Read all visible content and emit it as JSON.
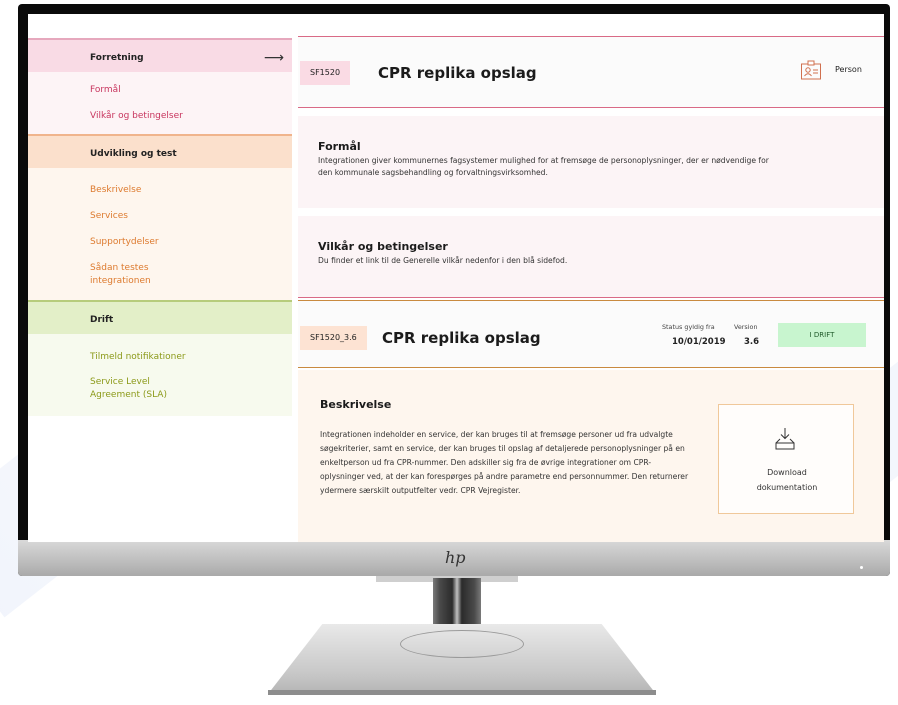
{
  "sidebar": {
    "forretning": {
      "title": "Forretning",
      "arrow": "⟶",
      "links": [
        "Formål",
        "Vilkår og betingelser"
      ]
    },
    "udvikling": {
      "title": "Udvikling og test",
      "links": [
        "Beskrivelse",
        "Services",
        "Supportydelser",
        "Sådan testes integrationen"
      ]
    },
    "drift": {
      "title": "Drift",
      "links": [
        "Tilmeld notifikationer",
        "Service Level Agreement (SLA)"
      ]
    }
  },
  "header": {
    "code": "SF1520",
    "title": "CPR replika opslag",
    "person_label": "Person"
  },
  "formaal": {
    "heading": "Formål",
    "text": "Integrationen giver kommunernes fagsystemer mulighed for at fremsøge de personoplysninger, der er nødvendige for den kommunale sagsbehandling og forvaltningsvirksomhed."
  },
  "vilkaar": {
    "heading": "Vilkår og betingelser",
    "text": "Du finder et link til de Generelle vilkår nedenfor i den blå sidefod."
  },
  "version_header": {
    "code": "SF1520_3.6",
    "title": "CPR replika opslag",
    "status_label": "Status gyldig fra",
    "status_date": "10/01/2019",
    "version_label": "Version",
    "version_value": "3.6",
    "status_badge": "I DRIFT"
  },
  "beskrivelse": {
    "heading": "Beskrivelse",
    "text": "Integrationen indeholder en service, der kan bruges til at fremsøge personer ud fra udvalgte søgekriterier, samt en service, der kan bruges til opslag af detaljerede personoplysninger på en enkeltperson ud fra CPR-nummer. Den adskiller sig fra de øvrige integrationer om CPR-oplysninger ved, at der kan forespørges på andre parametre end personnummer. Den returnerer ydermere særskilt outputfelter vedr. CPR Vejregister.",
    "download_label": "Download dokumentation"
  },
  "monitor": {
    "brand": "hp"
  },
  "colors": {
    "forretning": "#d4376b",
    "udvikling": "#e6833b",
    "drift": "#8c9a1a",
    "accent_line": "#d96a86",
    "badge_green": "#c8f5cf"
  }
}
